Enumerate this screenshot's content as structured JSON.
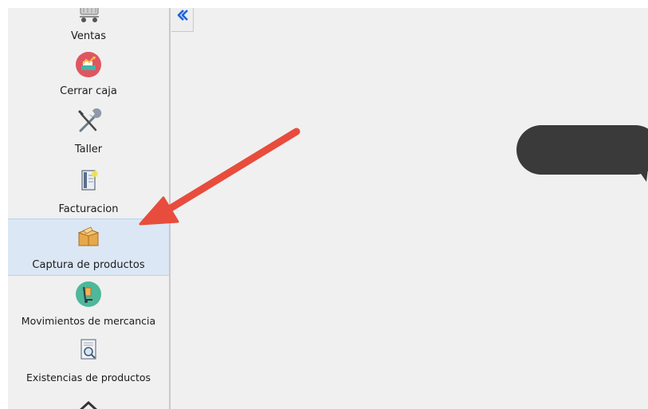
{
  "sidebar": {
    "items": [
      {
        "label": "Ventas",
        "icon": "shopping-cart-icon"
      },
      {
        "label": "Cerrar caja",
        "icon": "cash-register-icon"
      },
      {
        "label": "Taller",
        "icon": "tools-icon"
      },
      {
        "label": "Facturacion",
        "icon": "invoice-icon"
      },
      {
        "label": "Captura de productos",
        "icon": "product-box-icon",
        "selected": true
      },
      {
        "label": "Movimientos de mercancia",
        "icon": "hand-truck-icon"
      },
      {
        "label": "Existencias de productos",
        "icon": "inventory-search-icon"
      },
      {
        "label": "",
        "icon": "warehouse-icon"
      }
    ]
  },
  "collapse_tab": {
    "icon": "double-chevron-left-icon"
  },
  "annotation": {
    "arrow_color": "#e84c3d",
    "bubble_color": "#3a3a3a"
  },
  "colors": {
    "selected_background": "#dbe7f5",
    "panel_background": "#f0f0f0"
  }
}
